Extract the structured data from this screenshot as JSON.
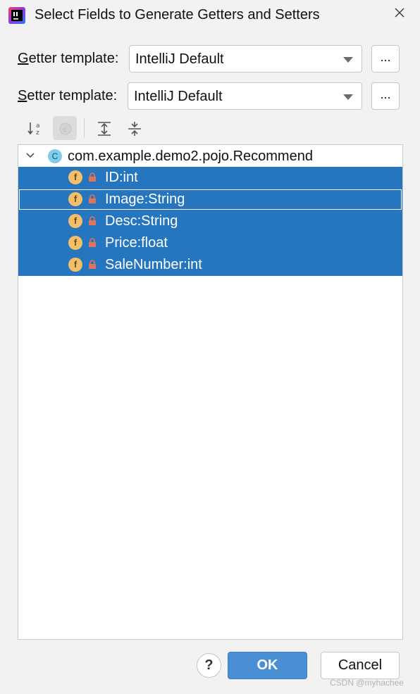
{
  "window": {
    "title": "Select Fields to Generate Getters and Setters",
    "app_icon": "intellij-icon",
    "close_icon": "close-icon"
  },
  "getter": {
    "label_mnemonic": "G",
    "label_rest": "etter template:",
    "value": "IntelliJ Default",
    "more_label": "..."
  },
  "setter": {
    "label_mnemonic": "S",
    "label_rest": "etter template:",
    "value": "IntelliJ Default",
    "more_label": "..."
  },
  "toolbar": {
    "items": [
      "sort-alphabetically-icon",
      "show-classes-icon",
      "expand-all-icon",
      "collapse-all-icon"
    ]
  },
  "tree": {
    "root": {
      "icon_letter": "C",
      "label": "com.example.demo2.pojo.Recommend"
    },
    "fields": [
      {
        "icon_letter": "f",
        "label": "ID:int",
        "selected": true,
        "focused": false
      },
      {
        "icon_letter": "f",
        "label": "Image:String",
        "selected": true,
        "focused": true
      },
      {
        "icon_letter": "f",
        "label": "Desc:String",
        "selected": true,
        "focused": false
      },
      {
        "icon_letter": "f",
        "label": "Price:float",
        "selected": true,
        "focused": false
      },
      {
        "icon_letter": "f",
        "label": "SaleNumber:int",
        "selected": true,
        "focused": false
      }
    ]
  },
  "footer": {
    "help_label": "?",
    "ok_label": "OK",
    "cancel_label": "Cancel"
  },
  "watermark": "CSDN @myhachee",
  "colors": {
    "selection": "#2675bf",
    "ok_button": "#4a8ed3",
    "field_icon": "#f4bf6a",
    "class_icon": "#7fcdec",
    "lock": "#e0735b"
  }
}
